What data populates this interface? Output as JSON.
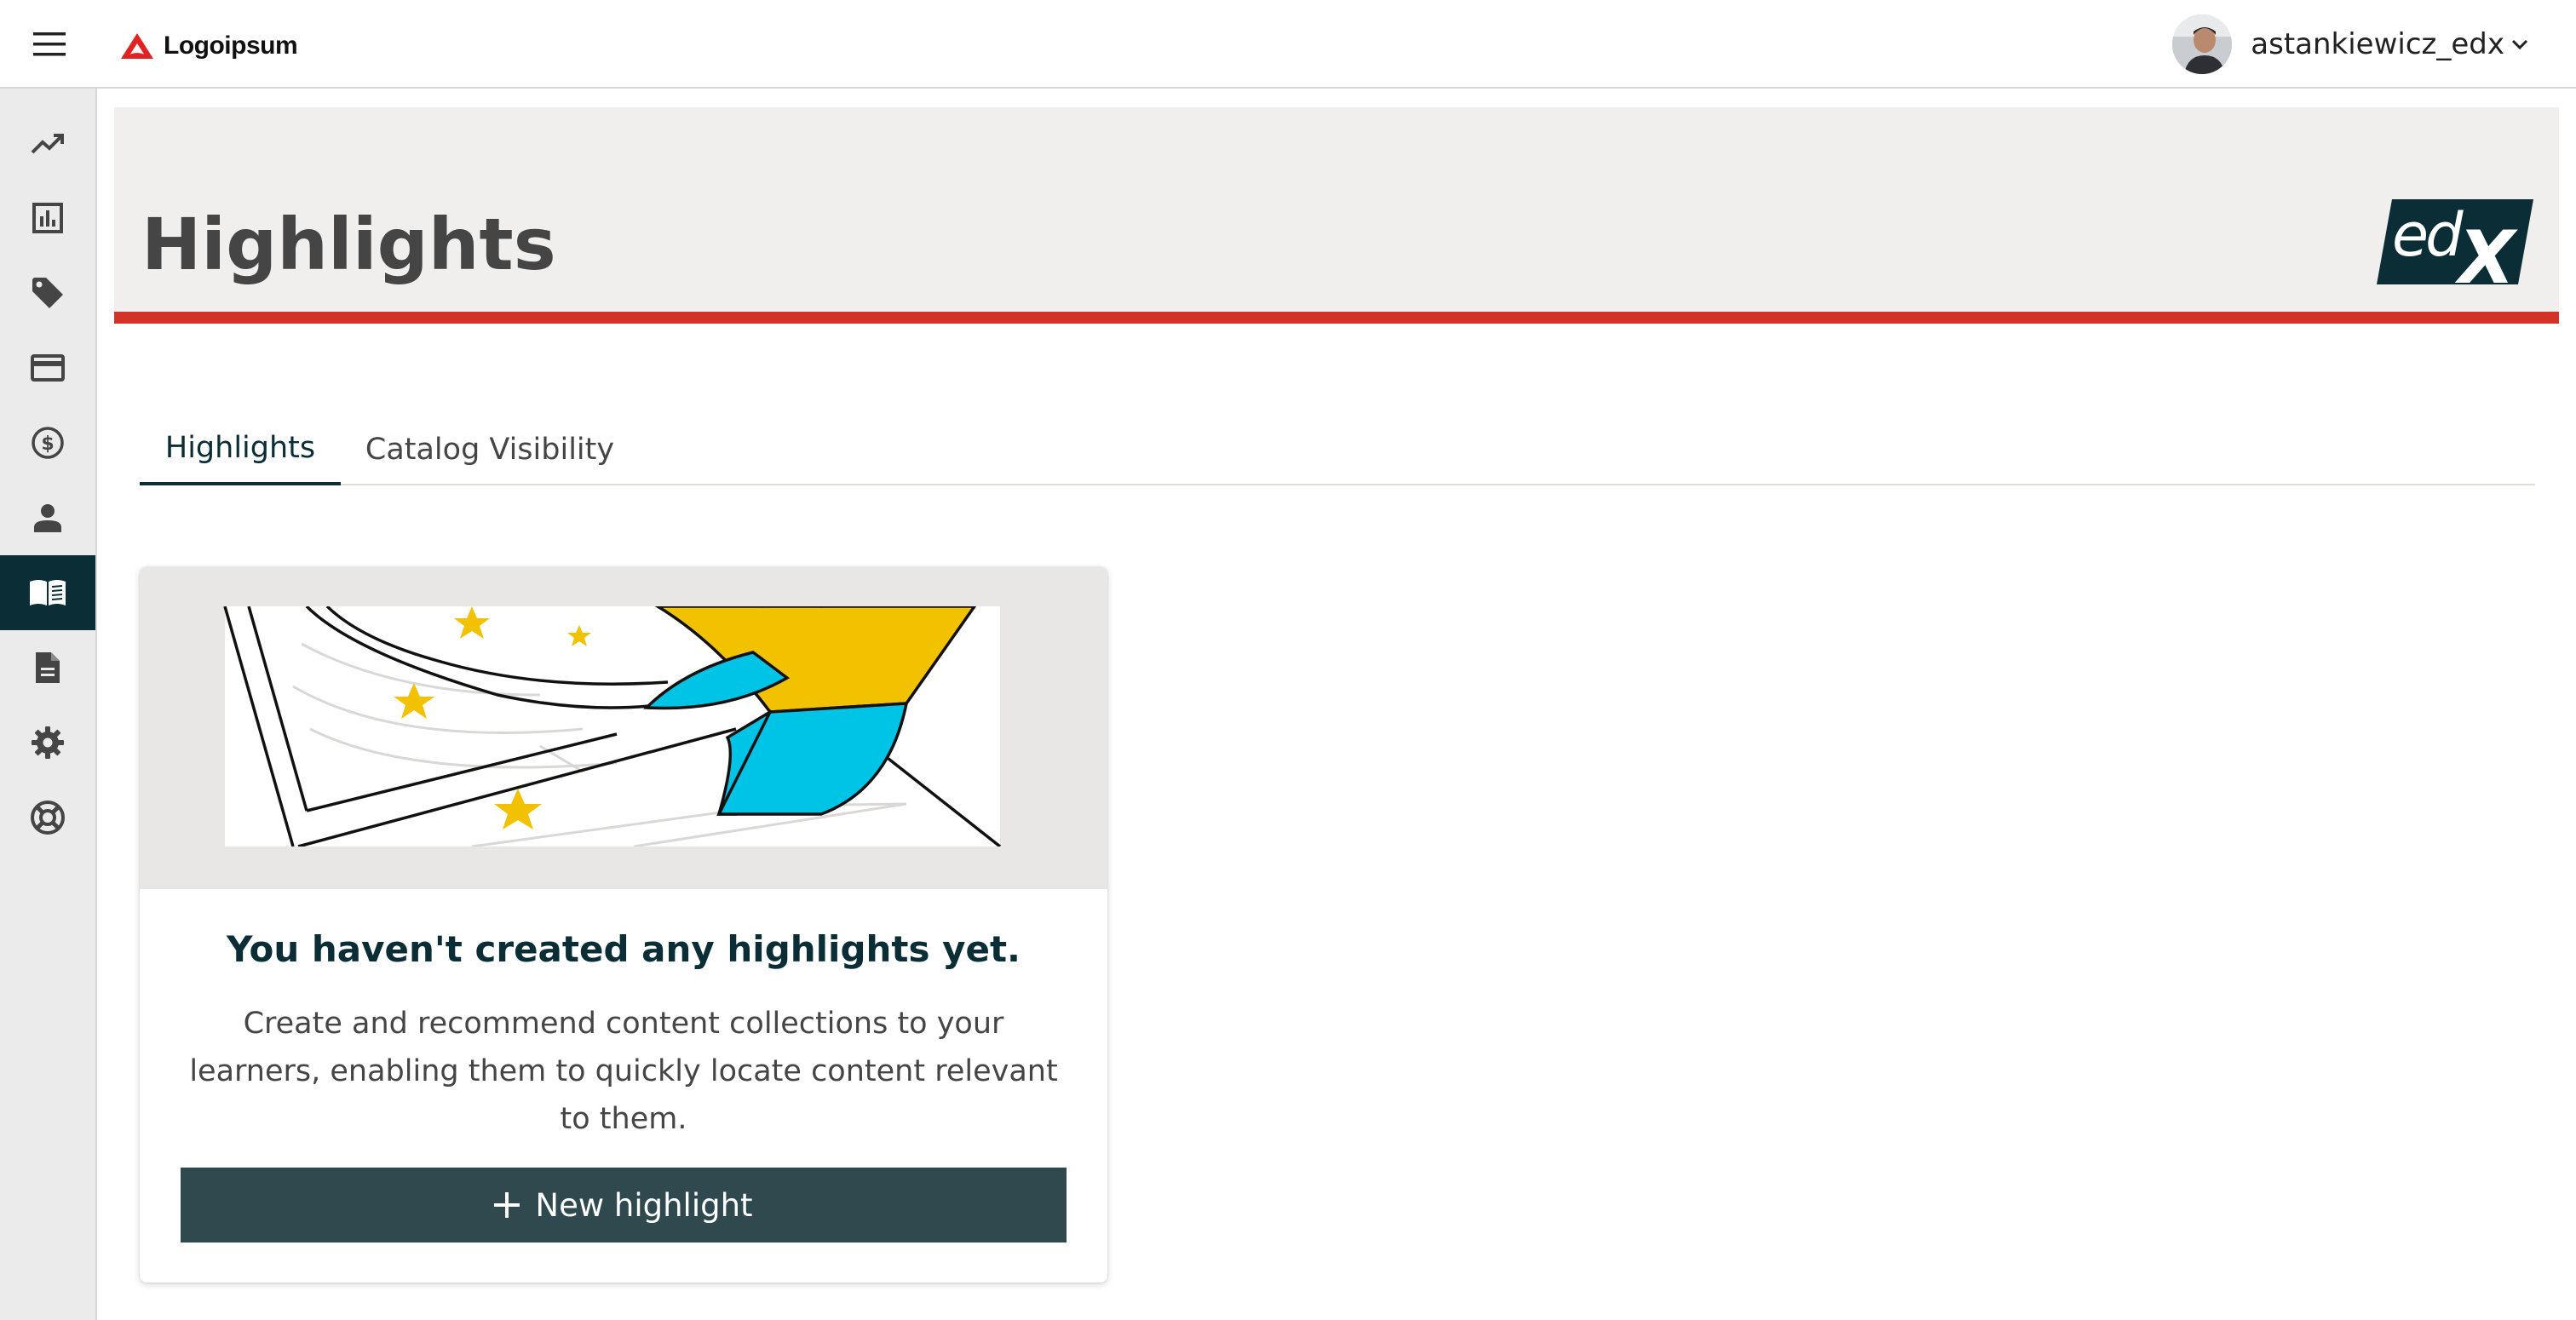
{
  "header": {
    "menu_icon": "hamburger-icon",
    "logo_text": "Logoipsum",
    "brand_color": "#e22222",
    "username": "astankiewicz_edx",
    "dropdown_icon": "chevron-down-icon"
  },
  "sidebar": {
    "items": [
      {
        "icon": "trending-up-icon",
        "active": false
      },
      {
        "icon": "bar-chart-icon",
        "active": false
      },
      {
        "icon": "tag-icon",
        "active": false
      },
      {
        "icon": "credit-card-icon",
        "active": false
      },
      {
        "icon": "dollar-icon",
        "active": false
      },
      {
        "icon": "person-icon",
        "active": false
      },
      {
        "icon": "book-icon",
        "active": true
      },
      {
        "icon": "document-icon",
        "active": false
      },
      {
        "icon": "gear-icon",
        "active": false
      },
      {
        "icon": "support-icon",
        "active": false
      }
    ]
  },
  "hero": {
    "title": "Highlights",
    "logo": "edx",
    "accent_color": "#d23228"
  },
  "tabs": [
    {
      "label": "Highlights",
      "active": true
    },
    {
      "label": "Catalog Visibility",
      "active": false
    }
  ],
  "empty_state": {
    "title": "You haven't created any highlights yet.",
    "description": "Create and recommend content collections to your learners, enabling them to quickly locate content relevant to them.",
    "button_label": "New highlight",
    "button_icon": "plus-icon",
    "button_color": "#2f494e"
  }
}
